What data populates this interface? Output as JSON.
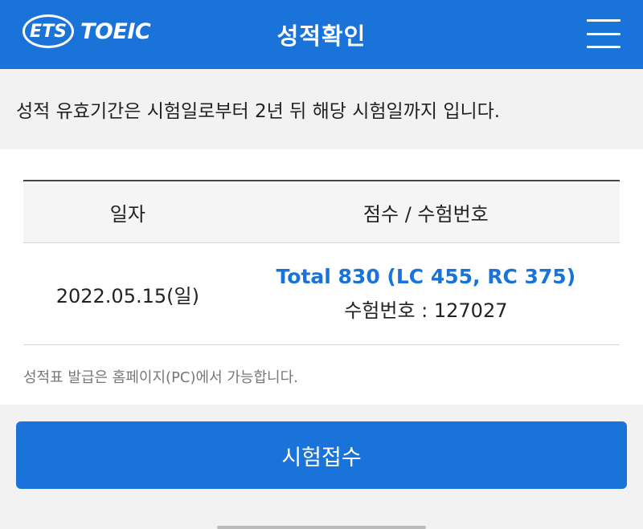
{
  "header": {
    "logo_ets": "ETS",
    "logo_toeic": "TOEIC",
    "title": "성적확인"
  },
  "notice": "성적 유효기간은 시험일로부터 2년 뒤 해당 시험일까지 입니다.",
  "table": {
    "headers": [
      "일자",
      "점수 / 수험번호"
    ],
    "rows": [
      {
        "date": "2022.05.15(일)",
        "total": "Total 830 (LC 455, RC 375)",
        "registration": "수험번호 : 127027"
      }
    ]
  },
  "footnote": "성적표 발급은 홈페이지(PC)에서 가능합니다.",
  "apply_button": "시험접수",
  "colors": {
    "brand": "#1a73d9"
  },
  "icons": {
    "menu": "hamburger-menu-icon"
  }
}
